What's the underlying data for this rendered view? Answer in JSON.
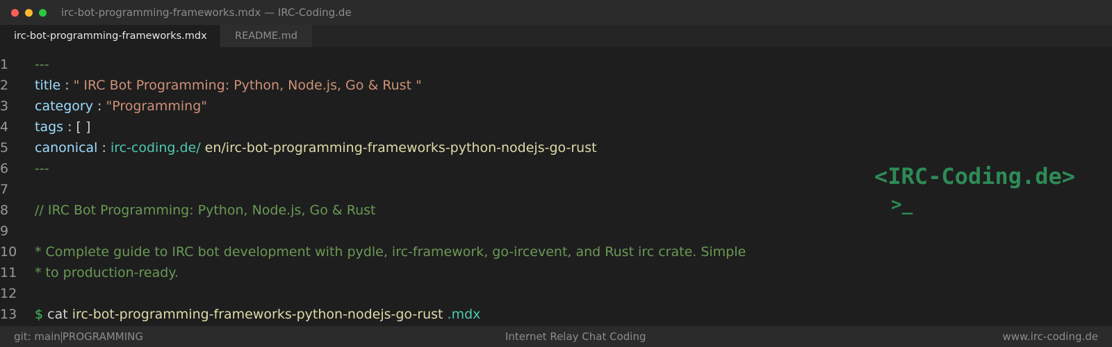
{
  "window": {
    "title": "irc-bot-programming-frameworks.mdx — IRC-Coding.de"
  },
  "tabs": [
    {
      "label": "irc-bot-programming-frameworks.mdx",
      "active": true
    },
    {
      "label": "README.md",
      "active": false
    }
  ],
  "editor": {
    "line_numbers": [
      "1",
      "2",
      "3",
      "4",
      "5",
      "6",
      "7",
      "8",
      "9",
      "10",
      "11",
      "12",
      "13"
    ],
    "frontmatter_open": "---",
    "title_key": "title",
    "title_sep": " : ",
    "title_value": "\" IRC Bot Programming: Python, Node.js, Go & Rust \"",
    "category_key": "category",
    "category_sep": " : ",
    "category_value": "\"Programming\"",
    "tags_key": "tags",
    "tags_sep": " : ",
    "tags_value": "[ ]",
    "canonical_key": "canonical",
    "canonical_sep": " : ",
    "canonical_domain": "irc-coding.de/",
    "canonical_path": " en/irc-bot-programming-frameworks-python-nodejs-go-rust",
    "frontmatter_close": "---",
    "comment_line": "// IRC Bot Programming: Python, Node.js, Go & Rust",
    "desc_line_1": "* Complete guide to IRC bot development with pydle, irc-framework, go-ircevent, and Rust irc crate. Simple",
    "desc_line_2": "* to production-ready.",
    "shell_prompt": "$",
    "shell_cmd": " cat ",
    "shell_file": "irc-bot-programming-frameworks-python-nodejs-go-rust",
    "shell_ext": " .mdx"
  },
  "brand": {
    "logo_text": "<IRC-Coding.de>",
    "prompt_text": ">_"
  },
  "statusbar": {
    "branch": "git: main",
    "section": "PROGRAMMING",
    "center": "Internet Relay Chat Coding",
    "right": "www.irc-coding.de"
  },
  "colors": {
    "background": "#1e1e1e",
    "brand_green": "#2e8b57",
    "comment_green": "#6a9955",
    "key_blue": "#9cdcfe",
    "string_orange": "#ce9178"
  }
}
